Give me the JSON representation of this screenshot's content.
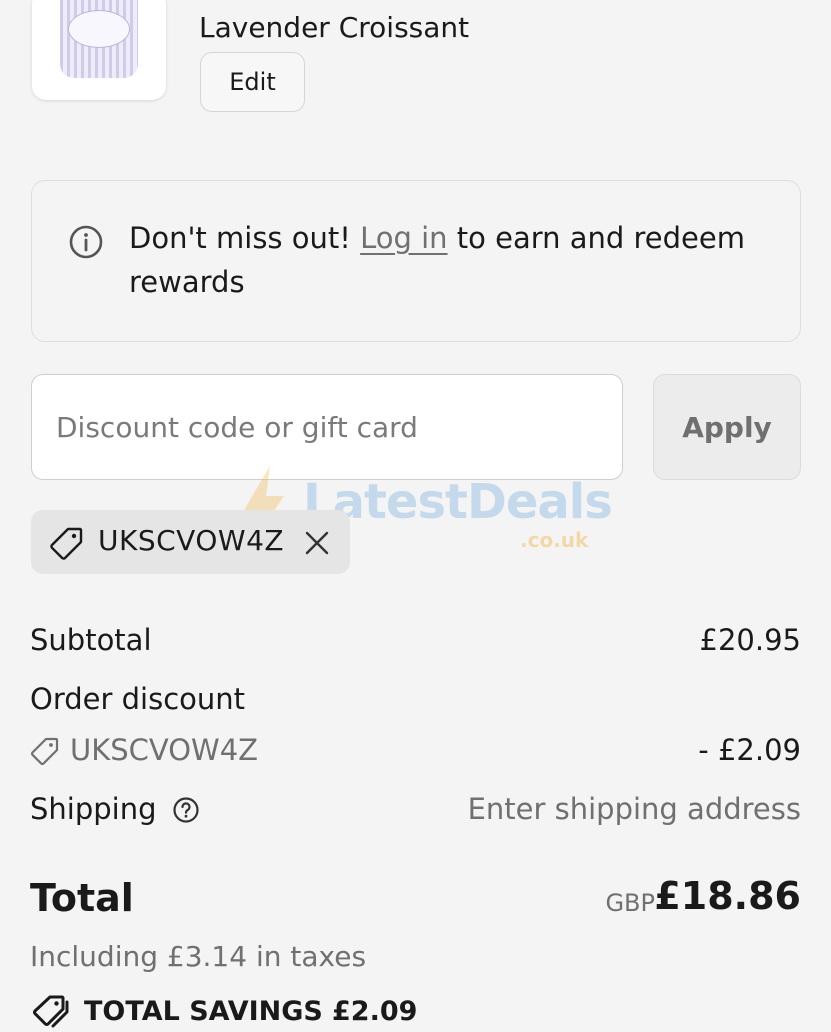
{
  "product": {
    "name": "Lavender Croissant",
    "edit_label": "Edit"
  },
  "rewards_banner": {
    "prefix": "Don't miss out! ",
    "link": "Log in",
    "suffix": " to earn and redeem rewards"
  },
  "discount": {
    "placeholder": "Discount code or gift card",
    "value": "",
    "apply_label": "Apply",
    "applied_code": "UKSCVOW4Z"
  },
  "watermark": {
    "text": "LatestDeals",
    "sub": ".co.uk"
  },
  "summary": {
    "subtotal_label": "Subtotal",
    "subtotal_value": "£20.95",
    "order_discount_label": "Order discount",
    "discount_code": "UKSCVOW4Z",
    "discount_value": "- £2.09",
    "shipping_label": "Shipping",
    "shipping_value": "Enter shipping address",
    "total_label": "Total",
    "currency": "GBP",
    "total_value": "£18.86",
    "taxes_note": "Including £3.14 in taxes",
    "savings_label": "TOTAL SAVINGS",
    "savings_value": "£2.09"
  },
  "icons": {
    "info": "info-icon",
    "tag": "tag-icon",
    "close": "close-icon",
    "help": "help-circle-icon",
    "savings": "tags-icon"
  },
  "colors": {
    "background": "#f4f4f4",
    "text": "#1a1a1a",
    "muted": "#707070",
    "chip": "#e5e5e5"
  }
}
